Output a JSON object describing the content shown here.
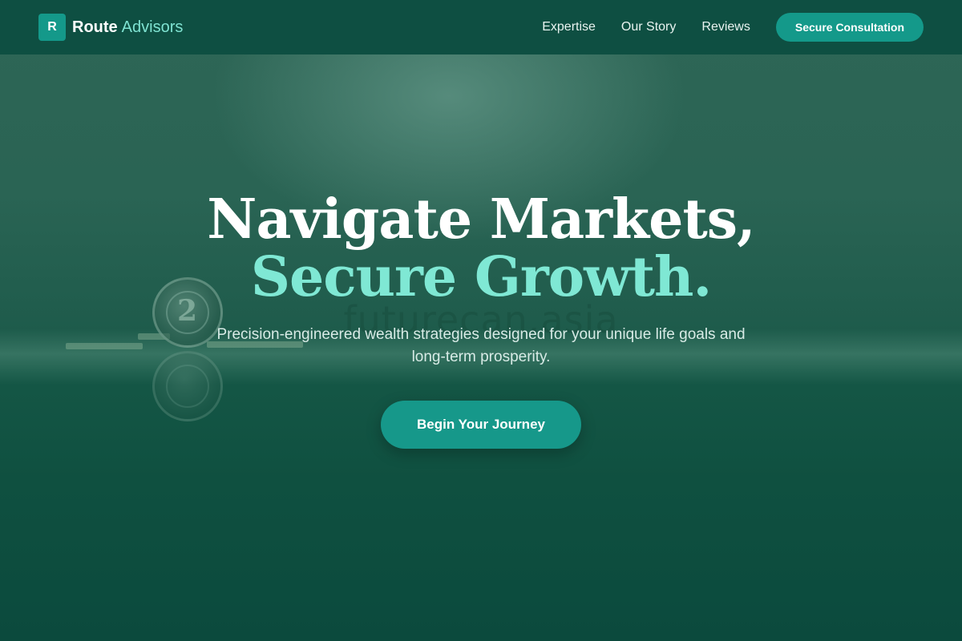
{
  "brand": {
    "logo_letter": "R",
    "name": "Route",
    "accent": "Advisors"
  },
  "nav": {
    "links": [
      "Expertise",
      "Our Story",
      "Reviews"
    ],
    "cta_label": "Secure Consultation"
  },
  "hero": {
    "headline_line1": "Navigate Markets,",
    "headline_line2": "Secure Growth.",
    "subtitle": "Precision-engineered wealth strategies designed for your unique life goals and long-term prosperity.",
    "cta_label": "Begin Your Journey",
    "background_watermark": "futurecan.asia",
    "coin_numeral": "2"
  },
  "colors": {
    "header_bg": "#0e4f42",
    "accent": "#14998a",
    "headline_accent": "#7fe8d4",
    "brand_accent": "#7fe3d2"
  }
}
